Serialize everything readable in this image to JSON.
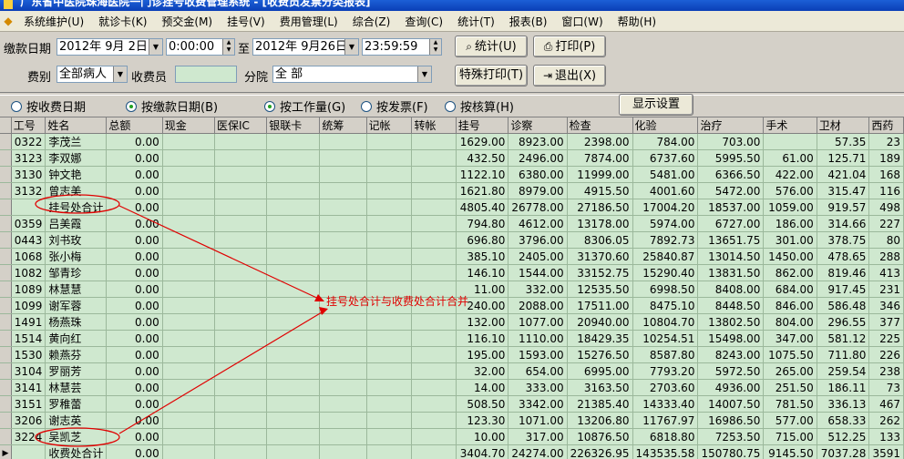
{
  "window": {
    "title": "广东省中医院珠海医院一门诊挂号收费管理系统 - [收费员发票分类报表]"
  },
  "menu": [
    "系统维护(U)",
    "就诊卡(K)",
    "预交金(M)",
    "挂号(V)",
    "费用管理(L)",
    "综合(Z)",
    "查询(C)",
    "统计(T)",
    "报表(B)",
    "窗口(W)",
    "帮助(H)"
  ],
  "filters": {
    "date_label": "缴款日期",
    "start_date": "2012年 9月 2日",
    "start_time": "0:00:00",
    "to_label": "至",
    "end_date": "2012年 9月26日",
    "end_time": "23:59:59",
    "fee_type_label": "费别",
    "fee_type": "全部病人",
    "cashier_label": "收费员",
    "cashier_value": "",
    "branch_label": "分院",
    "branch": "全 部"
  },
  "buttons": {
    "stats": "统计(U)",
    "print": "打印(P)",
    "special_print": "特殊打印(T)",
    "exit": "退出(X)",
    "display_settings": "显示设置"
  },
  "radios": {
    "by_charge_date": "按收费日期",
    "by_payment_date": "按缴款日期(B)",
    "by_workload": "按工作量(G)",
    "by_invoice": "按发票(F)",
    "by_audit": "按核算(H)"
  },
  "table": {
    "columns": [
      "工号",
      "姓名",
      "总额",
      "现金",
      "医保IC",
      "银联卡",
      "统筹",
      "记帐",
      "转帐",
      "挂号",
      "诊察",
      "检查",
      "化验",
      "治疗",
      "手术",
      "卫材",
      "西药"
    ],
    "rows": [
      [
        "0322",
        "李茂兰",
        "0.00",
        "",
        "",
        "",
        "",
        "",
        "",
        "1629.00",
        "8923.00",
        "2398.00",
        "784.00",
        "703.00",
        "",
        "57.35",
        "23"
      ],
      [
        "3123",
        "李双娜",
        "0.00",
        "",
        "",
        "",
        "",
        "",
        "",
        "432.50",
        "2496.00",
        "7874.00",
        "6737.60",
        "5995.50",
        "61.00",
        "125.71",
        "189"
      ],
      [
        "3130",
        "钟文艳",
        "0.00",
        "",
        "",
        "",
        "",
        "",
        "",
        "1122.10",
        "6380.00",
        "11999.00",
        "5481.00",
        "6366.50",
        "422.00",
        "421.04",
        "168"
      ],
      [
        "3132",
        "曾志美",
        "0.00",
        "",
        "",
        "",
        "",
        "",
        "",
        "1621.80",
        "8979.00",
        "4915.50",
        "4001.60",
        "5472.00",
        "576.00",
        "315.47",
        "116"
      ],
      [
        "",
        "挂号处合计",
        "0.00",
        "",
        "",
        "",
        "",
        "",
        "",
        "4805.40",
        "26778.00",
        "27186.50",
        "17004.20",
        "18537.00",
        "1059.00",
        "919.57",
        "498"
      ],
      [
        "0359",
        "吕美霞",
        "0.00",
        "",
        "",
        "",
        "",
        "",
        "",
        "794.80",
        "4612.00",
        "13178.00",
        "5974.00",
        "6727.00",
        "186.00",
        "314.66",
        "227"
      ],
      [
        "0443",
        "刘书玫",
        "0.00",
        "",
        "",
        "",
        "",
        "",
        "",
        "696.80",
        "3796.00",
        "8306.05",
        "7892.73",
        "13651.75",
        "301.00",
        "378.75",
        "80"
      ],
      [
        "1068",
        "张小梅",
        "0.00",
        "",
        "",
        "",
        "",
        "",
        "",
        "385.10",
        "2405.00",
        "31370.60",
        "25840.87",
        "13014.50",
        "1450.00",
        "478.65",
        "288"
      ],
      [
        "1082",
        "邹青珍",
        "0.00",
        "",
        "",
        "",
        "",
        "",
        "",
        "146.10",
        "1544.00",
        "33152.75",
        "15290.40",
        "13831.50",
        "862.00",
        "819.46",
        "413"
      ],
      [
        "1089",
        "林慧慧",
        "0.00",
        "",
        "",
        "",
        "",
        "",
        "",
        "11.00",
        "332.00",
        "12535.50",
        "6998.50",
        "8408.00",
        "684.00",
        "917.45",
        "231"
      ],
      [
        "1099",
        "谢军蓉",
        "0.00",
        "",
        "",
        "",
        "",
        "",
        "",
        "240.00",
        "2088.00",
        "17511.00",
        "8475.10",
        "8448.50",
        "846.00",
        "586.48",
        "346"
      ],
      [
        "1491",
        "杨燕珠",
        "0.00",
        "",
        "",
        "",
        "",
        "",
        "",
        "132.00",
        "1077.00",
        "20940.00",
        "10804.70",
        "13802.50",
        "804.00",
        "296.55",
        "377"
      ],
      [
        "1514",
        "黄向红",
        "0.00",
        "",
        "",
        "",
        "",
        "",
        "",
        "116.10",
        "1110.00",
        "18429.35",
        "10254.51",
        "15498.00",
        "347.00",
        "581.12",
        "225"
      ],
      [
        "1530",
        "赖燕芬",
        "0.00",
        "",
        "",
        "",
        "",
        "",
        "",
        "195.00",
        "1593.00",
        "15276.50",
        "8587.80",
        "8243.00",
        "1075.50",
        "711.80",
        "226"
      ],
      [
        "3104",
        "罗丽芳",
        "0.00",
        "",
        "",
        "",
        "",
        "",
        "",
        "32.00",
        "654.00",
        "6995.00",
        "7793.20",
        "5972.50",
        "265.00",
        "259.54",
        "238"
      ],
      [
        "3141",
        "林慧芸",
        "0.00",
        "",
        "",
        "",
        "",
        "",
        "",
        "14.00",
        "333.00",
        "3163.50",
        "2703.60",
        "4936.00",
        "251.50",
        "186.11",
        "73"
      ],
      [
        "3151",
        "罗稚蕾",
        "0.00",
        "",
        "",
        "",
        "",
        "",
        "",
        "508.50",
        "3342.00",
        "21385.40",
        "14333.40",
        "14007.50",
        "781.50",
        "336.13",
        "467"
      ],
      [
        "3206",
        "谢志英",
        "0.00",
        "",
        "",
        "",
        "",
        "",
        "",
        "123.30",
        "1071.00",
        "13206.80",
        "11767.97",
        "16986.50",
        "577.00",
        "658.33",
        "262"
      ],
      [
        "3224",
        "吴凯芝",
        "0.00",
        "",
        "",
        "",
        "",
        "",
        "",
        "10.00",
        "317.00",
        "10876.50",
        "6818.80",
        "7253.50",
        "715.00",
        "512.25",
        "133"
      ],
      [
        "",
        "收费处合计",
        "0.00",
        "",
        "",
        "",
        "",
        "",
        "",
        "3404.70",
        "24274.00",
        "226326.95",
        "143535.58",
        "150780.75",
        "9145.50",
        "7037.28",
        "3591"
      ]
    ]
  },
  "annotation": {
    "text": "挂号处合计与收费处合计合并",
    "color": "#e00000"
  }
}
